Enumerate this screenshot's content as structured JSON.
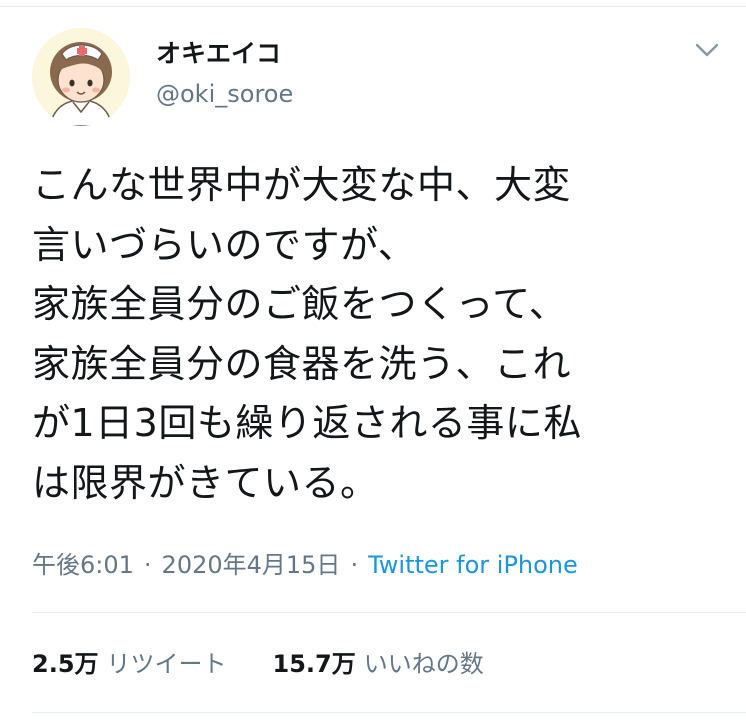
{
  "author": {
    "display_name": "オキエイコ",
    "handle": "@oki_soroe",
    "avatar_icon": "nurse-character-avatar"
  },
  "tweet": {
    "text": "こんな世界中が大変な中、大変\n言いづらいのですが、\n家族全員分のご飯をつくって、\n家族全員分の食器を洗う、これ\nが1日3回も繰り返される事に私\nは限界がきている。"
  },
  "meta": {
    "time": "午後6:01",
    "separator": "·",
    "date": "2020年4月15日",
    "source": "Twitter for iPhone"
  },
  "stats": {
    "retweets_count": "2.5万",
    "retweets_label": "リツイート",
    "likes_count": "15.7万",
    "likes_label": "いいねの数"
  },
  "colors": {
    "text": "#14171a",
    "secondary": "#657786",
    "link": "#1b95e0",
    "divider": "#e6ecf0"
  }
}
